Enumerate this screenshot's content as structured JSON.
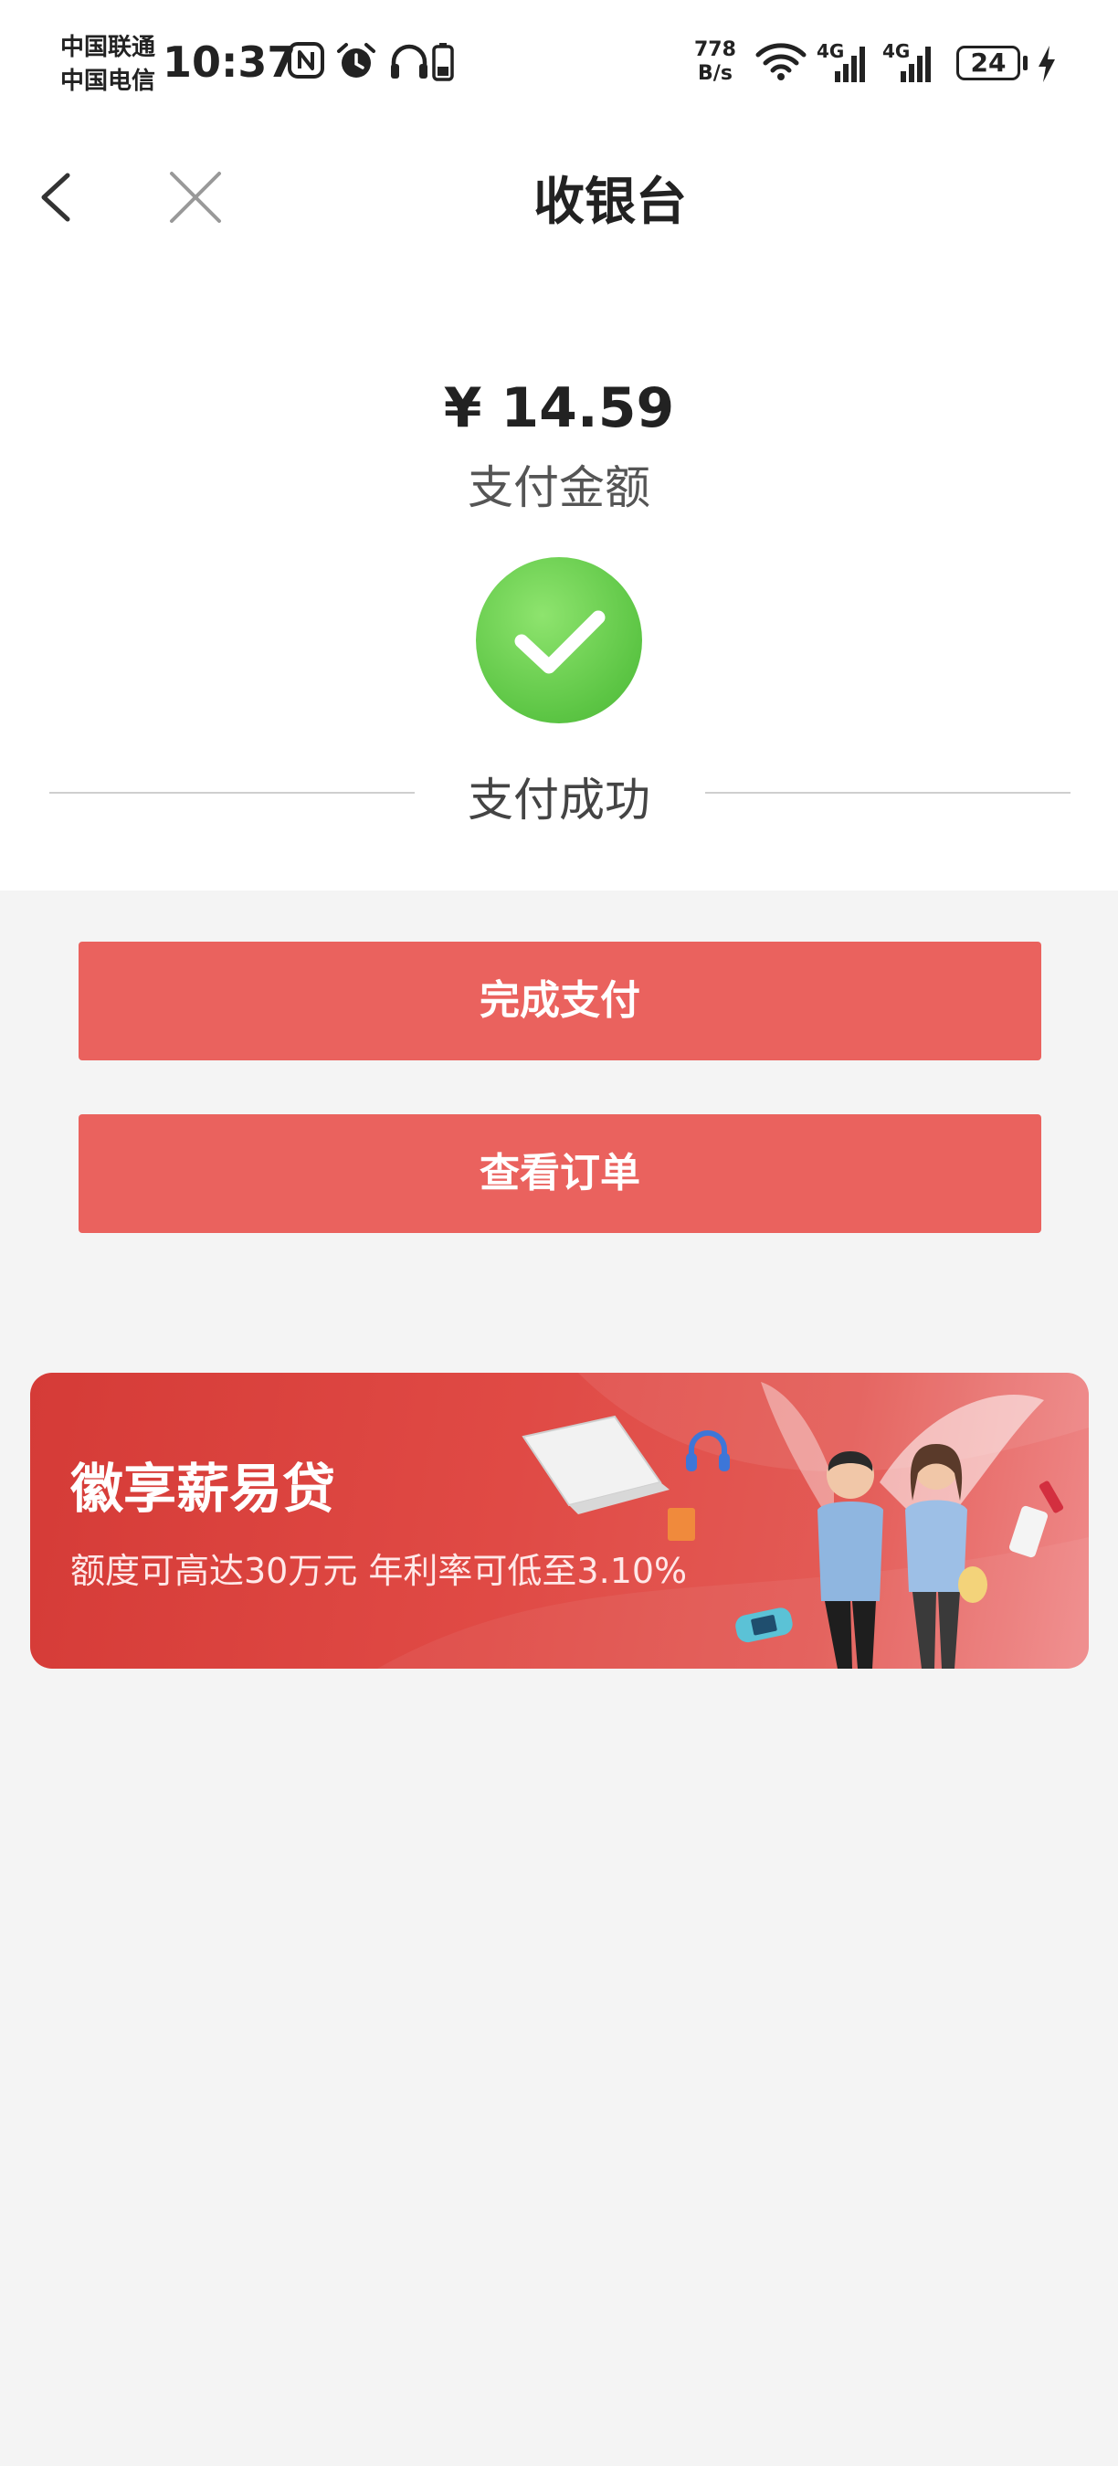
{
  "status_bar": {
    "carrier_1": "中国联通",
    "carrier_2": "中国电信",
    "time": "10:37",
    "speed_value": "778",
    "speed_unit": "B/s",
    "network_1": "4G",
    "network_2": "4G",
    "battery_level": "24"
  },
  "nav": {
    "title": "收银台"
  },
  "payment": {
    "amount": "¥ 14.59",
    "amount_label": "支付金额",
    "status_text": "支付成功"
  },
  "actions": {
    "complete_label": "完成支付",
    "view_order_label": "查看订单"
  },
  "banner": {
    "title": "徽享薪易贷",
    "subtitle": "额度可高达30万元  年利率可低至3.10%"
  },
  "colors": {
    "button_red": "#ea625e",
    "success_green": "#5cc544",
    "page_background": "#f4f4f4"
  },
  "icons": [
    "back-arrow-icon",
    "close-icon",
    "check-icon",
    "nfc-icon",
    "alarm-icon",
    "headphones-icon",
    "wifi-icon",
    "signal-icon",
    "battery-icon",
    "charging-icon"
  ]
}
